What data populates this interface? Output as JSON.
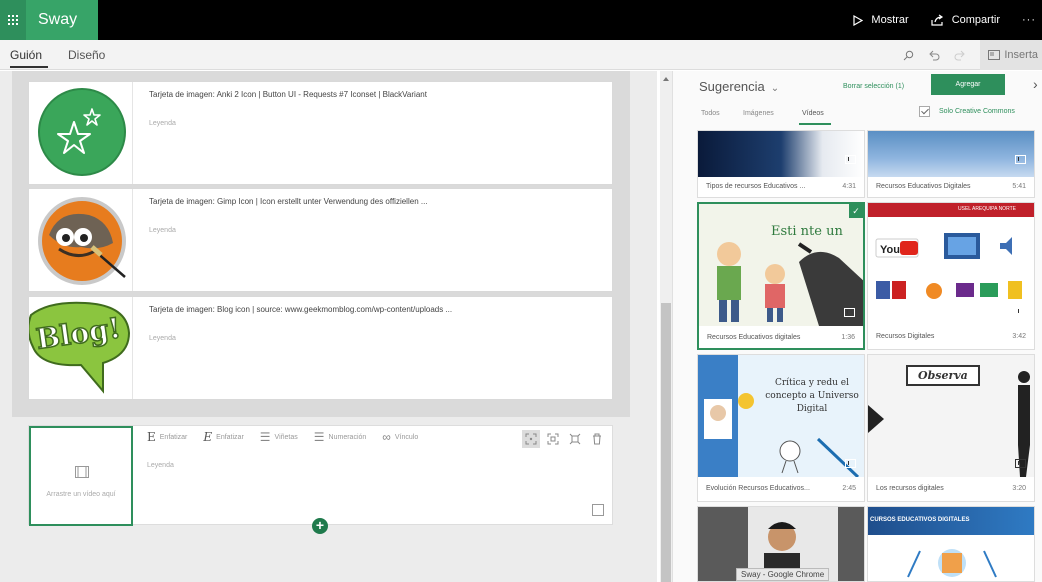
{
  "app": {
    "name": "Sway",
    "actions": {
      "present": "Mostrar",
      "share": "Compartir",
      "more": "···"
    }
  },
  "tabs": [
    {
      "label": "Guión",
      "active": true
    },
    {
      "label": "Diseño",
      "active": false
    }
  ],
  "tabs_tools": {
    "insert": "Inserta"
  },
  "cards": [
    {
      "title": "Tarjeta de imagen: Anki 2 Icon | Button UI - Requests #7 Iconset | BlackVariant",
      "caption": "Leyenda",
      "image": "anki-star-icon"
    },
    {
      "title": "Tarjeta de imagen: Gimp Icon | Icon erstellt unter Verwendung des offiziellen ...",
      "caption": "Leyenda",
      "image": "gimp-icon"
    },
    {
      "title": "Tarjeta de imagen: Blog icon | source: www.geekmomblog.com/wp-content/uploads ...",
      "caption": "Leyenda",
      "image": "blog-bubble-icon"
    }
  ],
  "editor": {
    "video_placeholder": "Arrastre un vídeo aquí",
    "caption": "Leyenda",
    "toolbar": [
      {
        "glyph": "E",
        "label": "Enfatizar"
      },
      {
        "glyph": "E",
        "label": "Enfatizar"
      },
      {
        "glyph": "☰",
        "label": "Viñetas"
      },
      {
        "glyph": "☰",
        "label": "Numeración"
      },
      {
        "glyph": "∞",
        "label": "Vínculo"
      }
    ]
  },
  "pane": {
    "title": "Sugerencia",
    "clear": "Borrar selección (1)",
    "add": "Agregar",
    "filters": [
      {
        "label": "Todos"
      },
      {
        "label": "Imágenes"
      },
      {
        "label": "Vídeos",
        "active": true
      }
    ],
    "creative_commons": "Solo Creative Commons",
    "videos": [
      {
        "title": "Tipos de recursos Educativos ...",
        "duration": "4:31"
      },
      {
        "title": "Recursos Educativos Digitales",
        "duration": "5:41"
      },
      {
        "title": "Recursos Educativos digitales",
        "duration": "1:36",
        "selected": true,
        "overlay": "Esti  nte un"
      },
      {
        "title": "Recursos Digitales",
        "duration": "3:42",
        "overlay": "USEL AREQUIPA NORTE"
      },
      {
        "title": "Evolución Recursos Educativos...",
        "duration": "2:45",
        "overlay": "Crítica y redu el concepto a Universo Digital"
      },
      {
        "title": "Los recursos digitales",
        "duration": "3:20",
        "overlay": "Observa"
      },
      {
        "title": "",
        "duration": ""
      },
      {
        "title": "",
        "duration": "",
        "overlay": "CURSOS EDUCATIVOS DIGITALES"
      }
    ]
  },
  "tooltip": "Sway - Google Chrome",
  "colors": {
    "brand_green": "#37a468",
    "dark_green": "#2e8f5c"
  }
}
